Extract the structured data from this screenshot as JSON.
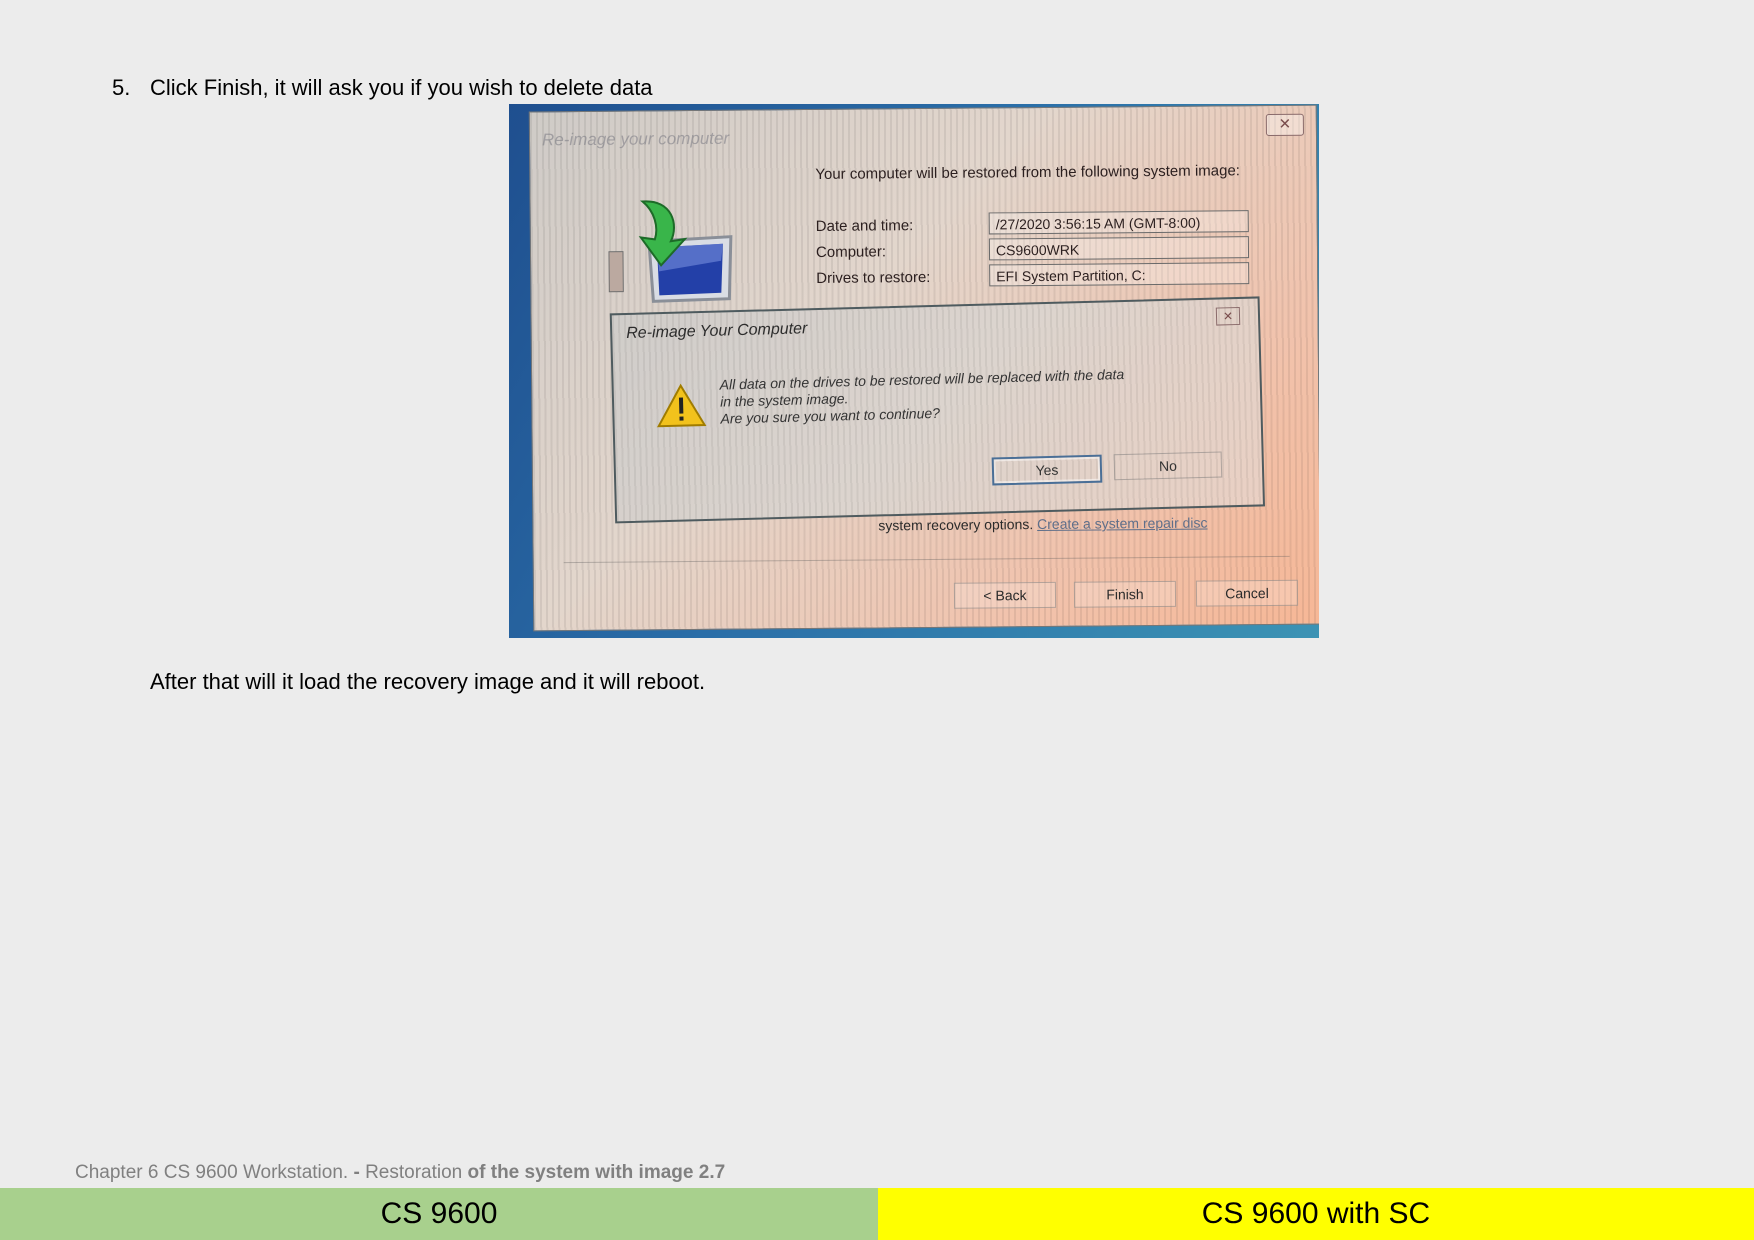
{
  "step": {
    "number": "5.",
    "text": "Click Finish, it will ask you if you wish to delete data"
  },
  "screenshot": {
    "window": {
      "title": "Re-image your computer",
      "close_glyph": "✕",
      "intro": "Your computer will be restored from the following system image:",
      "fields": [
        {
          "label": "Date and time:",
          "value": "/27/2020 3:56:15 AM (GMT-8:00)"
        },
        {
          "label": "Computer:",
          "value": "CS9600WRK"
        },
        {
          "label": "Drives to restore:",
          "value": "EFI System Partition, C:"
        }
      ],
      "recovery_text": "system recovery options.",
      "recovery_link": "Create a system repair disc",
      "buttons": {
        "back": "< Back",
        "finish": "Finish",
        "cancel": "Cancel"
      }
    },
    "dialog": {
      "title": "Re-image Your Computer",
      "close_glyph": "✕",
      "message_line1": "All data on the drives to be restored will be replaced with the data",
      "message_line2": "in the system image.",
      "message_line3": "Are you sure you want to continue?",
      "icon": "warning-icon",
      "buttons": {
        "yes": "Yes",
        "no": "No"
      }
    }
  },
  "after_text": "After that will it load the recovery image and it will reboot.",
  "footer": {
    "caption_prefix": "Chapter 6 CS 9600 Workstation. ",
    "caption_dash": "- ",
    "caption_mid": "Restoration ",
    "caption_bold": "of the system with image 2.7",
    "left_label": "CS 9600",
    "right_label": "CS 9600 with SC",
    "left_color": "#a8d08d",
    "right_color": "#ffff00"
  }
}
